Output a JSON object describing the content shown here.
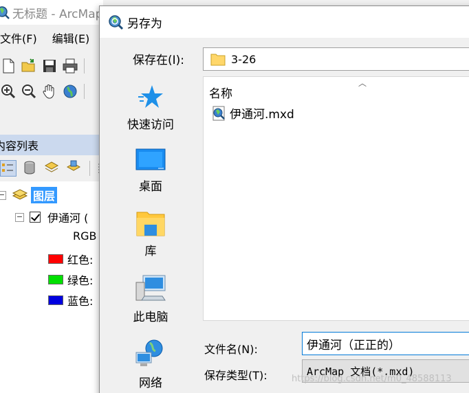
{
  "arcmap": {
    "title": "无标题 - ArcMap",
    "menu": [
      "文件(F)",
      "编辑(E)"
    ],
    "toc": {
      "header": "内容列表",
      "root_layer": "图层",
      "layer_name": "伊通河 (",
      "rgb_label": "RGB",
      "bands": [
        {
          "label": "红色:",
          "color": "#ff0000"
        },
        {
          "label": "绿色:",
          "color": "#00e000"
        },
        {
          "label": "蓝色:",
          "color": "#0000e0"
        }
      ]
    }
  },
  "dialog": {
    "title": "另存为",
    "save_in_label": "保存在(I):",
    "save_in_value": "3-26",
    "places": [
      {
        "label": "快速访问",
        "icon": "star-icon"
      },
      {
        "label": "桌面",
        "icon": "desktop-icon"
      },
      {
        "label": "库",
        "icon": "library-icon"
      },
      {
        "label": "此电脑",
        "icon": "computer-icon"
      },
      {
        "label": "网络",
        "icon": "network-icon"
      }
    ],
    "column_name": "名称",
    "files": [
      {
        "name": "伊通河.mxd",
        "icon": "mxd-file-icon"
      }
    ],
    "file_name_label": "文件名(N):",
    "file_name_value": "伊通河（正正的）",
    "file_type_label": "保存类型(T):",
    "file_type_value": "ArcMap 文档(*.mxd)"
  },
  "watermark": "https://blog.csdn.net/m0_48588113",
  "colors": {
    "accent": "#0078d7",
    "toc_header": "#cbd9ee",
    "selection": "#3399ff"
  }
}
